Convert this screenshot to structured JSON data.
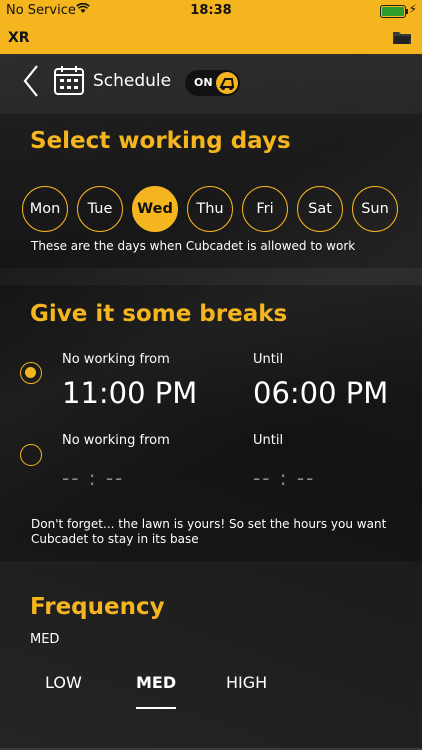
{
  "status": {
    "carrier": "No Service",
    "time": "18:38"
  },
  "appbar": {
    "title": "XR"
  },
  "nav": {
    "title": "Schedule",
    "toggle_label": "ON"
  },
  "days_section": {
    "heading": "Select working days",
    "days": [
      "Mon",
      "Tue",
      "Wed",
      "Thu",
      "Fri",
      "Sat",
      "Sun"
    ],
    "selected": "Wed",
    "note": "These are the days when Cubcadet is allowed to work"
  },
  "breaks_section": {
    "heading": "Give it some breaks",
    "rows": [
      {
        "from_label": "No working from",
        "from_value": "11:00 PM",
        "until_label": "Until",
        "until_value": "06:00 PM",
        "selected": true
      },
      {
        "from_label": "No working from",
        "from_value": "-- : --",
        "until_label": "Until",
        "until_value": "-- : --",
        "selected": false
      }
    ],
    "note_line1": "Don't forget... the lawn is yours! So set the hours you want",
    "note_line2": "Cubcadet to stay in its base"
  },
  "frequency_section": {
    "heading": "Frequency",
    "current": "MED",
    "options": [
      "LOW",
      "MED",
      "HIGH"
    ],
    "selected": "MED"
  },
  "colors": {
    "accent": "#f5b51e",
    "background": "#1e1e1e"
  }
}
